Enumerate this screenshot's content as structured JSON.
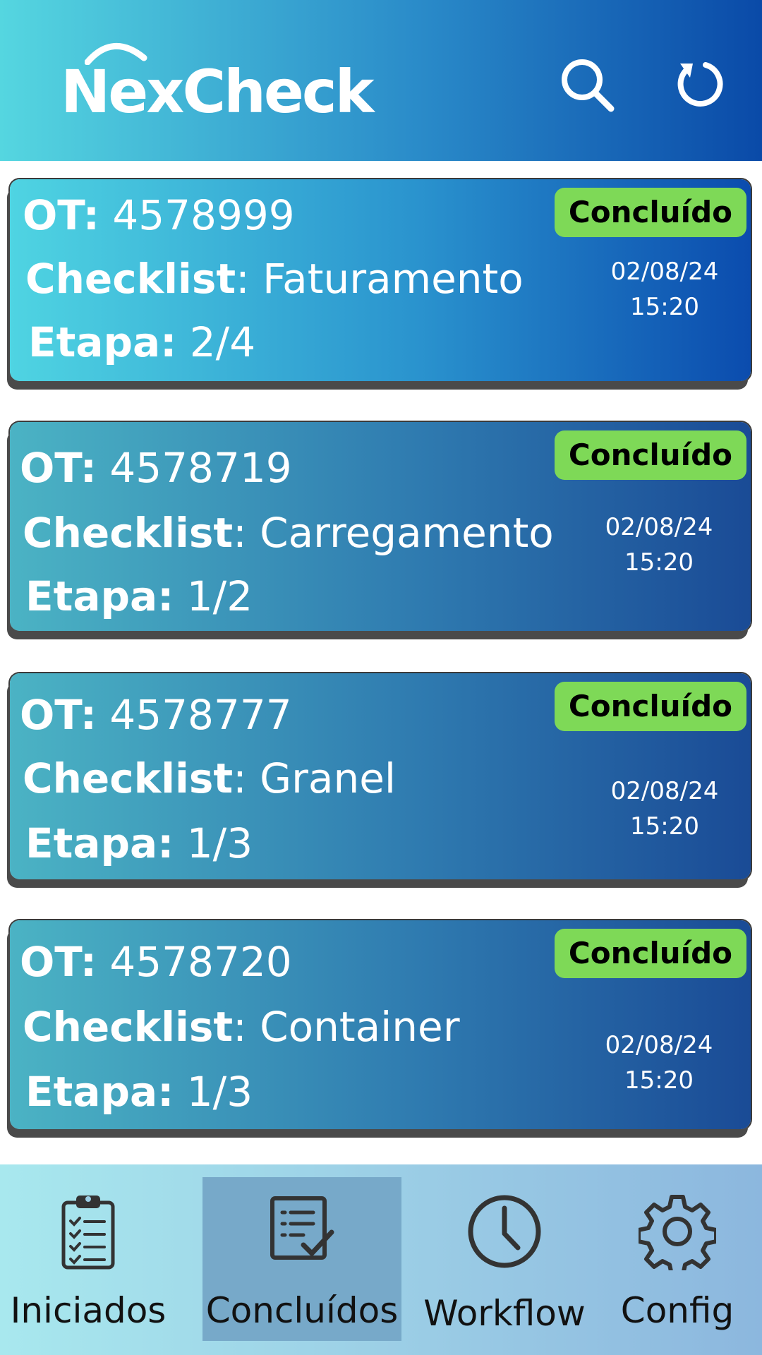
{
  "app": {
    "logo": "NexCheck"
  },
  "header": {
    "icons": [
      "search-icon",
      "refresh-icon"
    ]
  },
  "labels": {
    "ot": "OT:",
    "checklist": "Checklist",
    "etapa": "Etapa:"
  },
  "cards": [
    {
      "ot": "4578999",
      "checklist": "Faturamento",
      "etapa": "2/4",
      "status": "Concluído",
      "date": "02/08/24",
      "time": "15:20"
    },
    {
      "ot": "4578719",
      "checklist": "Carregamento",
      "etapa": "1/2",
      "status": "Concluído",
      "date": "02/08/24",
      "time": "15:20"
    },
    {
      "ot": "4578777",
      "checklist": "Granel",
      "etapa": "1/3",
      "status": "Concluído",
      "date": "02/08/24",
      "time": "15:20"
    },
    {
      "ot": "4578720",
      "checklist": "Container",
      "etapa": "1/3",
      "status": "Concluído",
      "date": "02/08/24",
      "time": "15:20"
    }
  ],
  "nav": {
    "items": [
      {
        "label": "Iniciados",
        "icon": "clipboard-checklist-icon",
        "active": false
      },
      {
        "label": "Concluídos",
        "icon": "checklist-done-icon",
        "active": true
      },
      {
        "label": "Workflow",
        "icon": "clock-icon",
        "active": false
      },
      {
        "label": "Config",
        "icon": "gear-icon",
        "active": false
      }
    ]
  },
  "colors": {
    "badge": "#7ed957",
    "header_start": "#55d6e0",
    "header_end": "#0a4aa8",
    "nav_active": "#77a9c9"
  }
}
